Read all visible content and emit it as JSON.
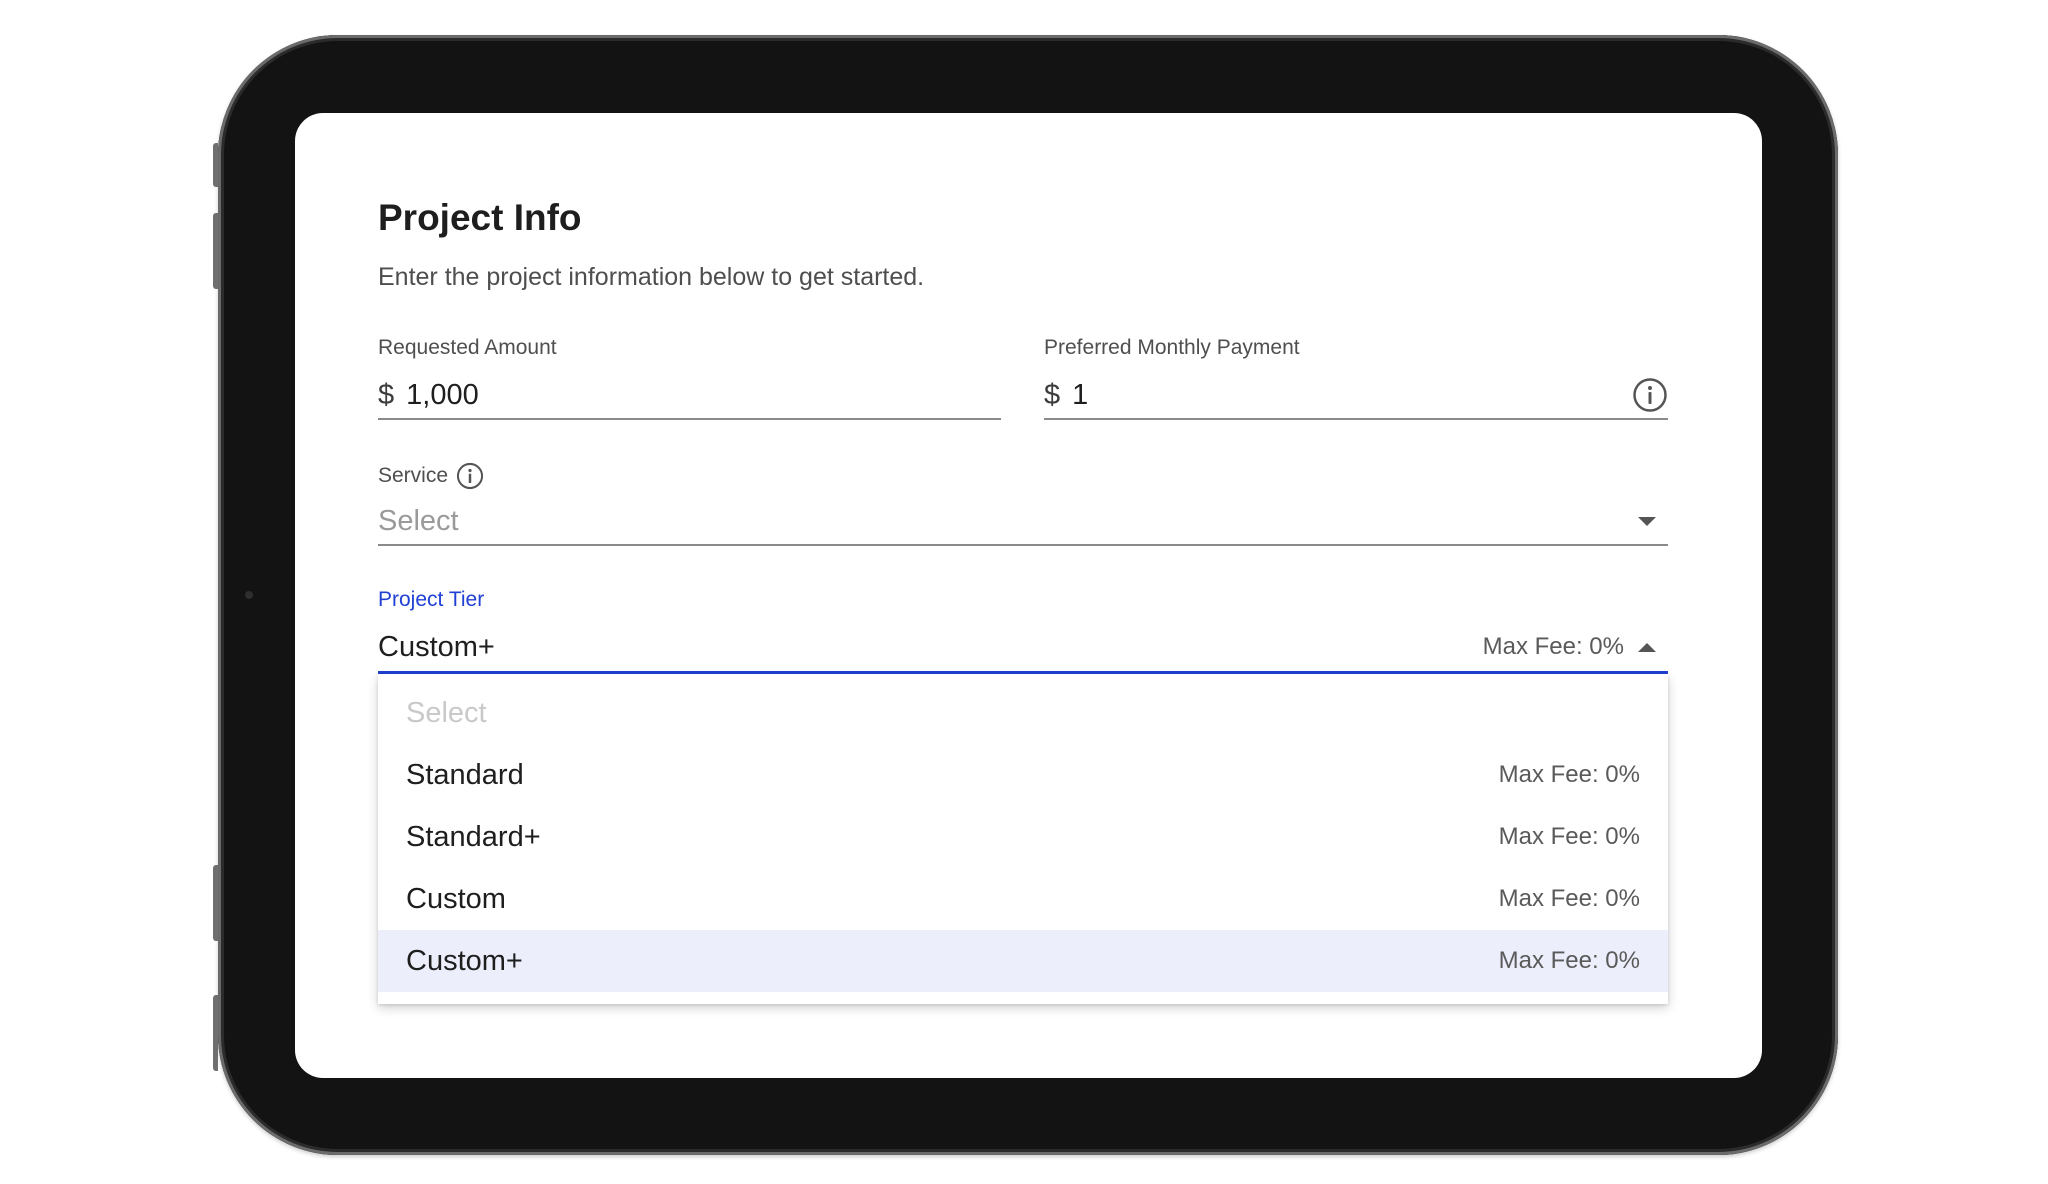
{
  "form": {
    "title": "Project Info",
    "subtitle": "Enter the project information below to get started."
  },
  "requested_amount": {
    "label": "Requested Amount",
    "currency": "$",
    "value": "1,000"
  },
  "monthly_payment": {
    "label": "Preferred Monthly Payment",
    "currency": "$",
    "value": "1"
  },
  "service": {
    "label": "Service",
    "placeholder": "Select"
  },
  "project_tier": {
    "label": "Project Tier",
    "value": "Custom+",
    "fee": "Max Fee: 0%",
    "menu": {
      "placeholder": "Select",
      "options": [
        {
          "label": "Standard",
          "fee": "Max Fee: 0%"
        },
        {
          "label": "Standard+",
          "fee": "Max Fee: 0%"
        },
        {
          "label": "Custom",
          "fee": "Max Fee: 0%"
        },
        {
          "label": "Custom+",
          "fee": "Max Fee: 0%",
          "selected": true
        }
      ]
    }
  },
  "colors": {
    "accent": "#2041d4",
    "selected_bg": "#eceefb",
    "device_frame": "#131313"
  },
  "icons": {
    "info": "info-circle-icon",
    "dropdown_closed": "chevron-down-icon",
    "dropdown_open": "chevron-up-icon"
  }
}
